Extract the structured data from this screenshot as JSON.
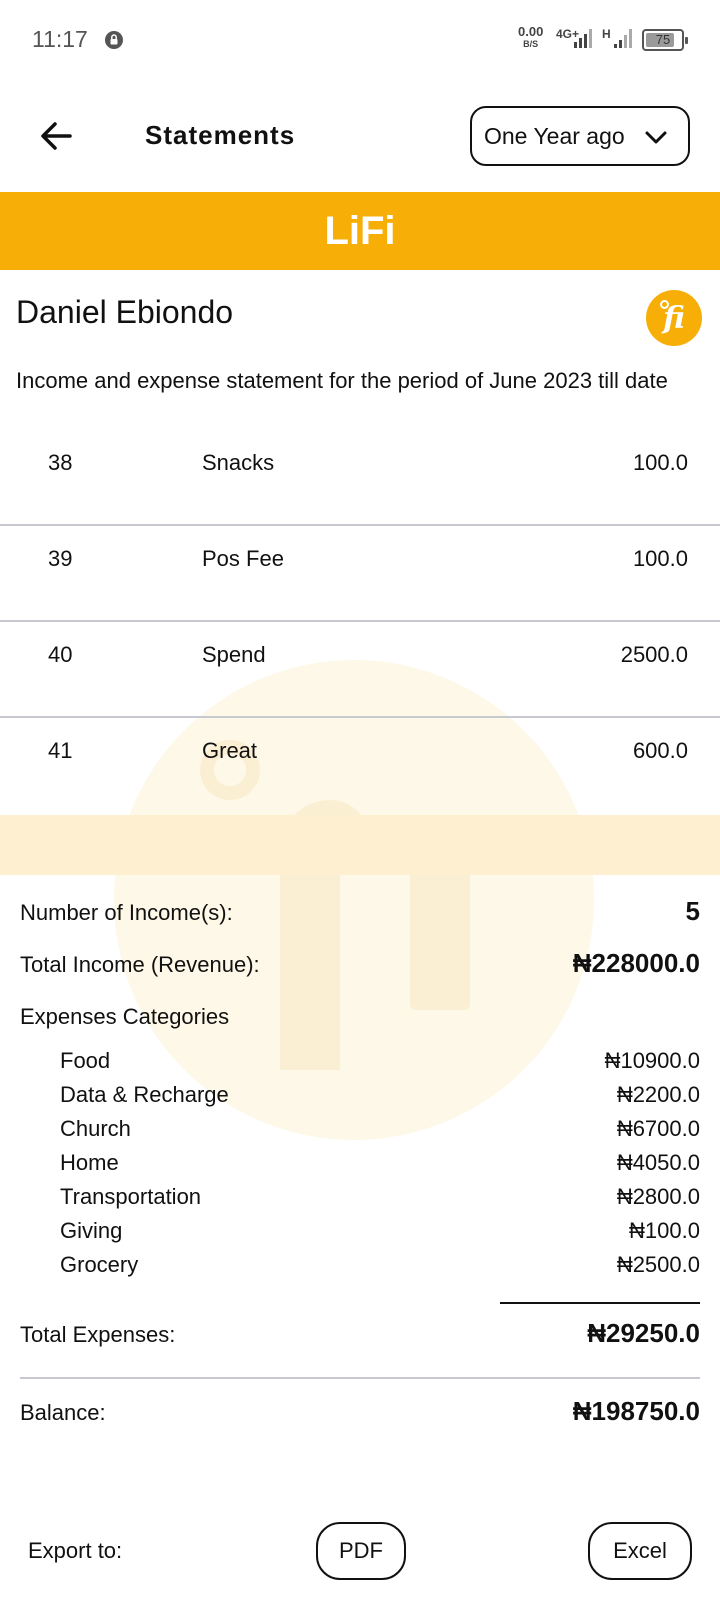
{
  "status_bar": {
    "time": "11:17",
    "net_speed_value": "0.00",
    "net_speed_unit": "B/S",
    "network_1": "4G+",
    "network_2": "H",
    "battery": "75"
  },
  "header": {
    "title": "Statements",
    "period_filter": "One Year ago"
  },
  "brand": {
    "name": "LiFi",
    "color": "#F7AF08"
  },
  "statement": {
    "user_name": "Daniel Ebiondo",
    "description": "Income and expense statement for the period of June 2023 till date"
  },
  "transactions": [
    {
      "no": "38",
      "description": "Snacks",
      "amount": "100.0"
    },
    {
      "no": "39",
      "description": "Pos Fee",
      "amount": "100.0"
    },
    {
      "no": "40",
      "description": "Spend",
      "amount": "2500.0"
    },
    {
      "no": "41",
      "description": "Great",
      "amount": "600.0"
    }
  ],
  "summary": {
    "income_count_label": "Number of Income(s):",
    "income_count": "5",
    "total_income_label": "Total Income (Revenue):",
    "total_income": "₦228000.0",
    "categories_label": "Expenses Categories",
    "categories": [
      {
        "name": "Food",
        "amount": "₦10900.0"
      },
      {
        "name": "Data & Recharge",
        "amount": "₦2200.0"
      },
      {
        "name": "Church",
        "amount": "₦6700.0"
      },
      {
        "name": "Home",
        "amount": "₦4050.0"
      },
      {
        "name": "Transportation",
        "amount": "₦2800.0"
      },
      {
        "name": "Giving",
        "amount": "₦100.0"
      },
      {
        "name": "Grocery",
        "amount": "₦2500.0"
      }
    ],
    "total_expenses_label": "Total Expenses:",
    "total_expenses": "₦29250.0",
    "balance_label": "Balance:",
    "balance": "₦198750.0"
  },
  "export": {
    "label": "Export to:",
    "pdf_label": "PDF",
    "excel_label": "Excel"
  }
}
